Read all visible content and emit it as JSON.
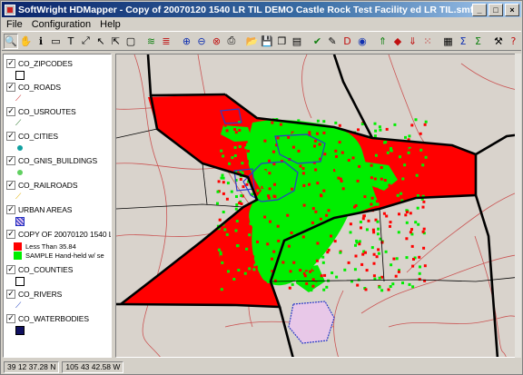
{
  "window": {
    "title": "SoftWright HDMapper - Copy of 20070120 1540 LR TIL DEMO Castle Rock Test Facility ed LR TIL.smf",
    "controls": {
      "minimize": "_",
      "maximize": "□",
      "close": "×"
    }
  },
  "menu": [
    "File",
    "Configuration",
    "Help"
  ],
  "toolbar": {
    "tools": [
      {
        "name": "zoom-tool-icon",
        "glyph": "🔍",
        "pressed": true
      },
      {
        "name": "pan-hand-icon",
        "glyph": "✋"
      },
      {
        "name": "info-icon",
        "glyph": "ℹ"
      },
      {
        "name": "label-tool-icon",
        "glyph": "▭"
      },
      {
        "name": "text-tool-icon",
        "glyph": "T"
      },
      {
        "name": "measure-tool-icon",
        "glyph": "⤢"
      },
      {
        "name": "select-arrow-icon",
        "glyph": "↖"
      },
      {
        "name": "pointer-plus-icon",
        "glyph": "⇱"
      },
      {
        "name": "layer-box-icon",
        "glyph": "▢"
      },
      {
        "name": "layers-icon",
        "glyph": "≋",
        "sep": true
      },
      {
        "name": "layers-stack-icon",
        "glyph": "≣"
      },
      {
        "name": "zoom-in-icon",
        "glyph": "⊕",
        "sep": true
      },
      {
        "name": "zoom-out-icon",
        "glyph": "⊖"
      },
      {
        "name": "zoom-extents-icon",
        "glyph": "⊗"
      },
      {
        "name": "print-icon",
        "glyph": "⎙"
      },
      {
        "name": "open-folder-icon",
        "glyph": "📂",
        "sep": true
      },
      {
        "name": "save-disk-icon",
        "glyph": "💾"
      },
      {
        "name": "copy-icon",
        "glyph": "❐"
      },
      {
        "name": "page-icon",
        "glyph": "▤"
      },
      {
        "name": "checkmark-icon",
        "glyph": "✔",
        "sep": true
      },
      {
        "name": "map-edit-icon",
        "glyph": "✎"
      },
      {
        "name": "dxf-icon",
        "glyph": "D"
      },
      {
        "name": "globe-icon",
        "glyph": "◉"
      },
      {
        "name": "layer-up-icon",
        "glyph": "⇑",
        "sep": true
      },
      {
        "name": "layer-color-icon",
        "glyph": "◆"
      },
      {
        "name": "layer-down-icon",
        "glyph": "⇓"
      },
      {
        "name": "grid-points-icon",
        "glyph": "⁙"
      },
      {
        "name": "table-icon",
        "glyph": "▦",
        "sep": true
      },
      {
        "name": "sum-icon",
        "glyph": "Σ"
      },
      {
        "name": "sum-plus-icon",
        "glyph": "Σ"
      },
      {
        "name": "tools-icon",
        "glyph": "⚒",
        "sep": true
      },
      {
        "name": "help-icon",
        "glyph": "?"
      }
    ]
  },
  "legend": {
    "layers": [
      {
        "name": "CO_ZIPCODES",
        "checked": true,
        "symbol": "box",
        "color": "#ffffff"
      },
      {
        "name": "CO_ROADS",
        "checked": true,
        "symbol": "line",
        "color": "#cc2020"
      },
      {
        "name": "CO_USROUTES",
        "checked": true,
        "symbol": "line",
        "color": "#207020"
      },
      {
        "name": "CO_CITIES",
        "checked": true,
        "symbol": "dot",
        "color": "#10a0a0"
      },
      {
        "name": "CO_GNIS_BUILDINGS",
        "checked": true,
        "symbol": "dot",
        "color": "#60d060"
      },
      {
        "name": "CO_RAILROADS",
        "checked": true,
        "symbol": "line",
        "color": "#e0b000"
      },
      {
        "name": "URBAN AREAS",
        "checked": true,
        "symbol": "hatch",
        "color": "#2030c0"
      },
      {
        "name": "COPY OF 20070120 1540 LR T",
        "checked": true,
        "symbol": "none",
        "color": "#000000",
        "sub": [
          {
            "label": "Less Than 35.84",
            "color": "#ff0000"
          },
          {
            "label": "SAMPLE Hand-held w/ se",
            "color": "#00ee00"
          }
        ]
      },
      {
        "name": "CO_COUNTIES",
        "checked": true,
        "symbol": "box",
        "color": "#ffffff"
      },
      {
        "name": "CO_RIVERS",
        "checked": true,
        "symbol": "line",
        "color": "#2040c0"
      },
      {
        "name": "CO_WATERBODIES",
        "checked": true,
        "symbol": "fill",
        "color": "#101060"
      }
    ]
  },
  "map": {
    "colors": {
      "background": "#d9d3cc",
      "coverage_red": "#ff0000",
      "coverage_green": "#00ee00",
      "county_border": "#000000",
      "road": "#c84040",
      "urban": "#2a3cc8"
    }
  },
  "status": {
    "latitude": "39 12 37.28 N",
    "longitude": "105 43 42.58 W"
  }
}
